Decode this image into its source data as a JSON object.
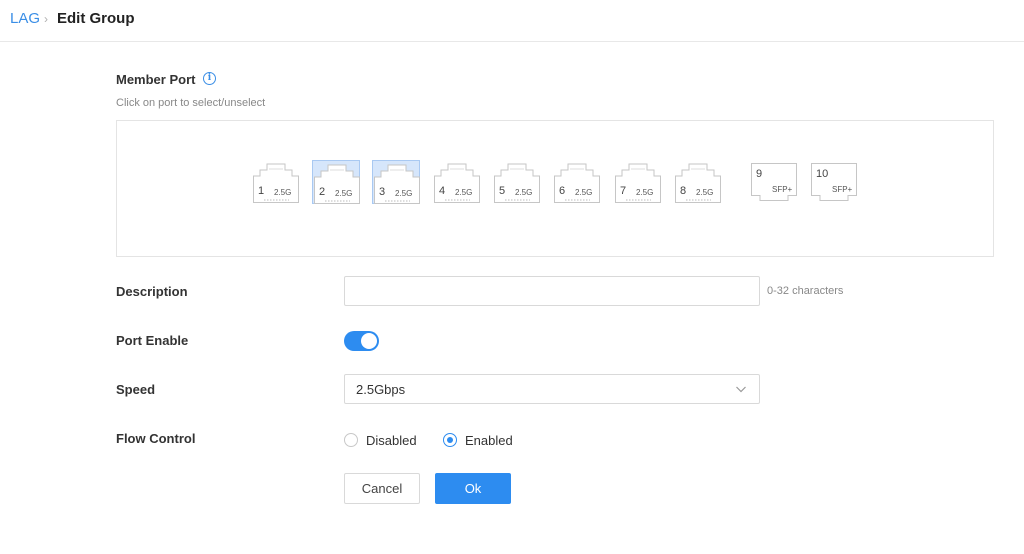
{
  "breadcrumb": {
    "root": "LAG",
    "separator": "›",
    "current": "Edit Group"
  },
  "member_port": {
    "label": "Member Port",
    "info_icon": "info-icon",
    "hint": "Click on port to select/unselect",
    "ports": [
      {
        "number": "1",
        "speed": "2.5G",
        "type": "rj45",
        "selected": false
      },
      {
        "number": "2",
        "speed": "2.5G",
        "type": "rj45",
        "selected": true
      },
      {
        "number": "3",
        "speed": "2.5G",
        "type": "rj45",
        "selected": true
      },
      {
        "number": "4",
        "speed": "2.5G",
        "type": "rj45",
        "selected": false
      },
      {
        "number": "5",
        "speed": "2.5G",
        "type": "rj45",
        "selected": false
      },
      {
        "number": "6",
        "speed": "2.5G",
        "type": "rj45",
        "selected": false
      },
      {
        "number": "7",
        "speed": "2.5G",
        "type": "rj45",
        "selected": false
      },
      {
        "number": "8",
        "speed": "2.5G",
        "type": "rj45",
        "selected": false
      },
      {
        "number": "9",
        "speed": "SFP+",
        "type": "sfp",
        "selected": false
      },
      {
        "number": "10",
        "speed": "SFP+",
        "type": "sfp",
        "selected": false
      }
    ]
  },
  "description": {
    "label": "Description",
    "value": "",
    "hint": "0-32 characters"
  },
  "port_enable": {
    "label": "Port Enable",
    "enabled": true
  },
  "speed": {
    "label": "Speed",
    "value": "2.5Gbps",
    "icon": "chevron-down-icon"
  },
  "flow_control": {
    "label": "Flow Control",
    "options": [
      {
        "label": "Disabled",
        "checked": false
      },
      {
        "label": "Enabled",
        "checked": true
      }
    ]
  },
  "actions": {
    "cancel": "Cancel",
    "ok": "Ok"
  },
  "colors": {
    "accent": "#2d8cf0",
    "link": "#3a8ee6",
    "selected_port_bg": "#d6e6fb"
  }
}
